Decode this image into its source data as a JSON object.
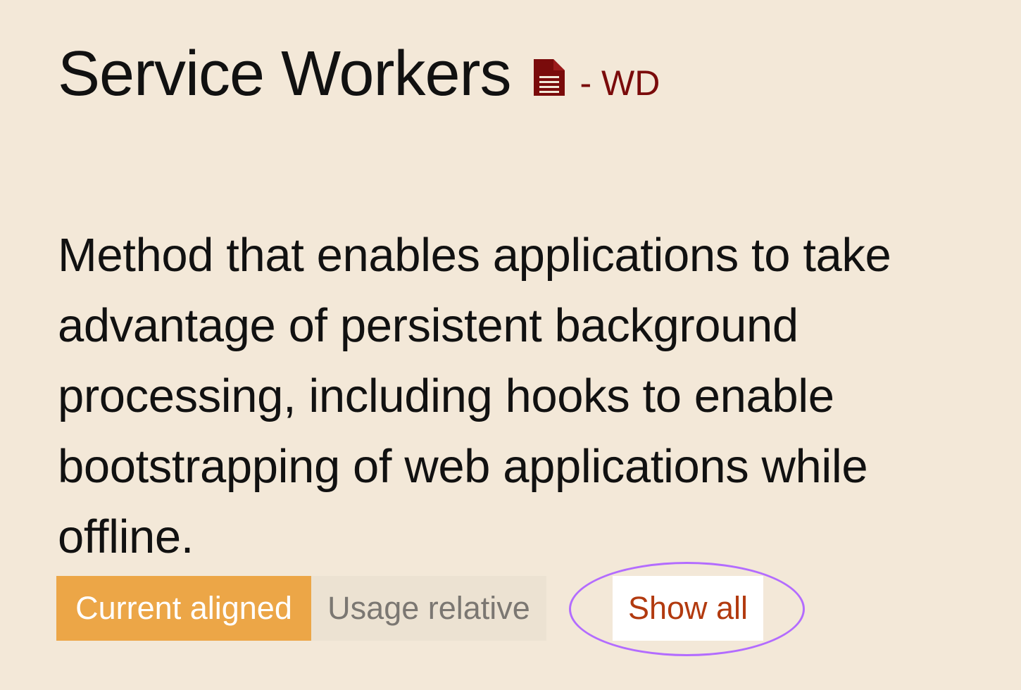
{
  "feature": {
    "title": "Service Workers",
    "status": "- WD",
    "spec_icon": "document-icon",
    "description": "Method that enables applications to take advantage of persistent background processing, including hooks to enable bootstrapping of web applications while offline."
  },
  "controls": {
    "current_aligned": "Current aligned",
    "usage_relative": "Usage relative",
    "show_all": "Show all"
  },
  "colors": {
    "background": "#f3e8d8",
    "accent": "#eca647",
    "status_red": "#7a0b0b",
    "link_red": "#b23a0f",
    "highlight": "#b36cff"
  }
}
